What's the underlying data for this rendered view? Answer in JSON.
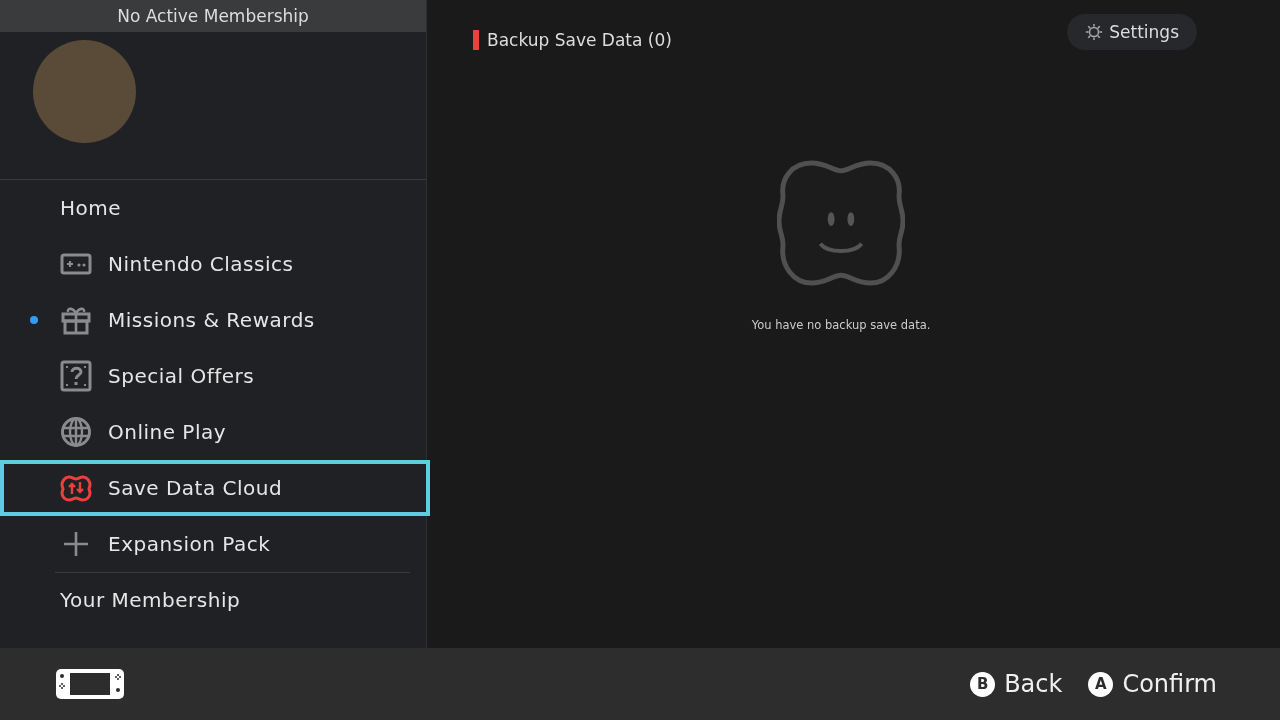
{
  "sidebar": {
    "header": "No Active Membership",
    "items": [
      {
        "label": "Home",
        "kind": "plain",
        "selected": false,
        "new_badge": false
      },
      {
        "label": "Nintendo Classics",
        "kind": "controller",
        "selected": false,
        "new_badge": false
      },
      {
        "label": "Missions & Rewards",
        "kind": "gift",
        "selected": false,
        "new_badge": true
      },
      {
        "label": "Special Offers",
        "kind": "question",
        "selected": false,
        "new_badge": false
      },
      {
        "label": "Online Play",
        "kind": "globe",
        "selected": false,
        "new_badge": false
      },
      {
        "label": "Save Data Cloud",
        "kind": "cloud",
        "selected": true,
        "new_badge": false
      },
      {
        "label": "Expansion Pack",
        "kind": "plus",
        "selected": false,
        "new_badge": false
      }
    ],
    "membership_link": "Your Membership"
  },
  "main": {
    "title": "Backup Save Data (0)",
    "settings_button": "Settings",
    "empty_message": "You have no backup save data."
  },
  "footer": {
    "buttons": [
      {
        "glyph": "B",
        "label": "Back"
      },
      {
        "glyph": "A",
        "label": "Confirm"
      }
    ]
  }
}
